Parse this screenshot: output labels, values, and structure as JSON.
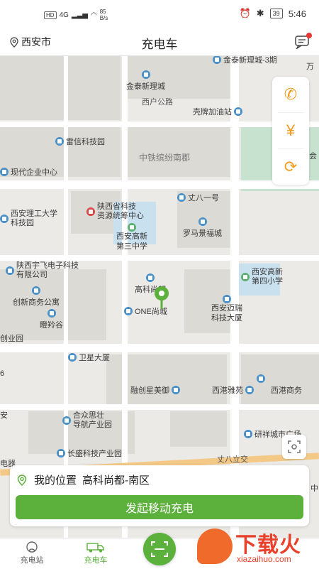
{
  "status_bar": {
    "left_badges": [
      "HD",
      "4G"
    ],
    "net_speed_value": "85",
    "net_speed_unit": "B/s",
    "battery": "39",
    "time": "5:46"
  },
  "header": {
    "city": "西安市",
    "title": "充电车"
  },
  "map": {
    "road_labels": [
      "西户公路",
      "丈八立交"
    ],
    "pois": [
      {
        "label": "金泰新理城",
        "icon": "building-icon"
      },
      {
        "label": "壳牌加油站",
        "icon": "gas-station-icon"
      },
      {
        "label": "雷信科技园",
        "icon": "building-icon"
      },
      {
        "label": "中铁缤纷南郡",
        "icon": "none"
      },
      {
        "label": "现代企业中心",
        "icon": "building-icon"
      },
      {
        "label": "丈八一号",
        "icon": "building-icon"
      },
      {
        "label": "陕西省科技",
        "label2": "资源统筹中心",
        "icon": "landmark-icon"
      },
      {
        "label": "西安理工大学",
        "label2": "科技园",
        "icon": "building-icon"
      },
      {
        "label": "罗马景福城",
        "icon": "building-icon"
      },
      {
        "label": "西安高新",
        "label2": "第三中学",
        "icon": "school-icon"
      },
      {
        "label": "陕西宇飞电子科技",
        "label2": "有限公司",
        "icon": "building-icon"
      },
      {
        "label": "西安高新",
        "label2": "第四小学",
        "icon": "school-icon"
      },
      {
        "label": "高科尚都",
        "icon": "building-icon"
      },
      {
        "label": "创新商务公寓",
        "icon": "building-icon"
      },
      {
        "label": "ONE尚城",
        "icon": "building-icon"
      },
      {
        "label": "西安迈瑞",
        "label2": "科技大厦",
        "icon": "building-icon"
      },
      {
        "label": "瞪羚谷",
        "icon": "building-icon"
      },
      {
        "label": "创业园",
        "icon": "building-icon"
      },
      {
        "label": "卫星大厦",
        "icon": "building-icon"
      },
      {
        "label": "融创星美御",
        "icon": "building-icon"
      },
      {
        "label": "西港雅苑",
        "icon": "building-icon"
      },
      {
        "label": "西港商务",
        "icon": "building-icon"
      },
      {
        "label": "合众思壮",
        "label2": "导航产业园",
        "icon": "building-icon"
      },
      {
        "label": "研祥城市广场",
        "icon": "building-icon"
      },
      {
        "label": "长盛科技产业园",
        "icon": "building-icon"
      },
      {
        "label": "金泰新理城-3期",
        "icon": "building-icon"
      },
      {
        "label": "万",
        "icon": "none"
      },
      {
        "label": "会",
        "icon": "none"
      },
      {
        "label": "安",
        "icon": "none"
      },
      {
        "label": "电器",
        "icon": "none"
      },
      {
        "label": "中",
        "icon": "none"
      },
      {
        "label": "6",
        "icon": "none"
      }
    ],
    "tools": [
      "phone-icon",
      "yuan-icon",
      "refresh-icon"
    ]
  },
  "card": {
    "location_label": "我的位置",
    "location_value": "高科尚都-南区",
    "action_button": "发起移动充电"
  },
  "tabbar": {
    "tabs": [
      {
        "label": "充电站",
        "active": false
      },
      {
        "label": "充电车",
        "active": true
      }
    ]
  },
  "watermark": {
    "title": "下载火",
    "url": "xiazaihuo.com"
  },
  "colors": {
    "accent": "#5cb03c",
    "tool_orange": "#f29b1d",
    "poi_blue": "#4a90c8",
    "watermark_red": "#e8402a"
  }
}
